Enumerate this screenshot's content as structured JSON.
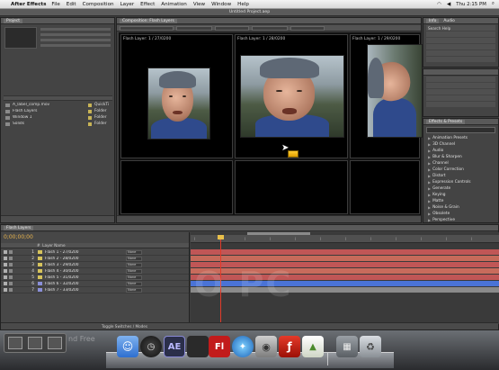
{
  "menubar": {
    "app": "After Effects",
    "items": [
      "File",
      "Edit",
      "Composition",
      "Layer",
      "Effect",
      "Animation",
      "View",
      "Window",
      "Help"
    ],
    "clock": "Thu 2:15 PM"
  },
  "app_title": "Untitled Project.aep",
  "project": {
    "tab": "Project",
    "items": [
      {
        "name": "A_label_comp.mov",
        "type": "QuickTi"
      },
      {
        "name": "Flash Layers",
        "type": "Folder"
      },
      {
        "name": "Window 1",
        "type": "Folder"
      },
      {
        "name": "Solids",
        "type": "Folder"
      }
    ]
  },
  "comp": {
    "tab": "Composition: Flash Layers",
    "panes": [
      {
        "label": "Flash Layer: 1 / 27/0200"
      },
      {
        "label": "Flash Layer: 1 / 28/0200"
      },
      {
        "label": "Flash Layer: 1 / 29/0200"
      }
    ]
  },
  "info": {
    "tabs": [
      "Info",
      "Audio"
    ],
    "search_label": "Search Help"
  },
  "effects": {
    "tab": "Effects & Presets",
    "categories": [
      "Animation Presets",
      "3D Channel",
      "Audio",
      "Blur & Sharpen",
      "Channel",
      "Color Correction",
      "Distort",
      "Expression Controls",
      "Generate",
      "Keying",
      "Matte",
      "Noise & Grain",
      "Obsolete",
      "Perspective",
      "Text"
    ]
  },
  "timeline": {
    "tab": "Flash Layers",
    "timecode": "0;00;00;00",
    "layers": [
      {
        "num": "1",
        "name": "Flash 1 - 27/0200",
        "parent": "None",
        "color": "#d6c35c"
      },
      {
        "num": "2",
        "name": "Flash 2 - 28/0200",
        "parent": "None",
        "color": "#d6c35c"
      },
      {
        "num": "3",
        "name": "Flash 3 - 29/0200",
        "parent": "None",
        "color": "#d6c35c"
      },
      {
        "num": "4",
        "name": "Flash 4 - 30/0200",
        "parent": "None",
        "color": "#d6c35c"
      },
      {
        "num": "5",
        "name": "Flash 5 - 31/0200",
        "parent": "None",
        "color": "#d6c35c"
      },
      {
        "num": "6",
        "name": "Flash 6 - 32/0200",
        "parent": "None",
        "color": "#8a8fd8"
      },
      {
        "num": "7",
        "name": "Flash 7 - 33/0200",
        "parent": "None",
        "color": "#8a8fd8"
      }
    ],
    "track_colors": [
      "#c05656",
      "#c66a5a",
      "#c05656",
      "#c86b5c",
      "#c05656",
      "#4a73d6",
      "#8a8a8a"
    ],
    "bottom_label": "Toggle Switches / Modes",
    "watermark": "O  PC"
  },
  "dock": {
    "icons": [
      "finder-icon",
      "dashboard-icon",
      "after-effects-icon",
      "flash-icon",
      "photoshop-icon",
      "safari-icon",
      "flash-player-icon",
      "installer-icon",
      "downloads-icon",
      "trash-icon"
    ],
    "ae_label": "AE",
    "fl_label": "Fl"
  },
  "overlay_text": "nd Free"
}
